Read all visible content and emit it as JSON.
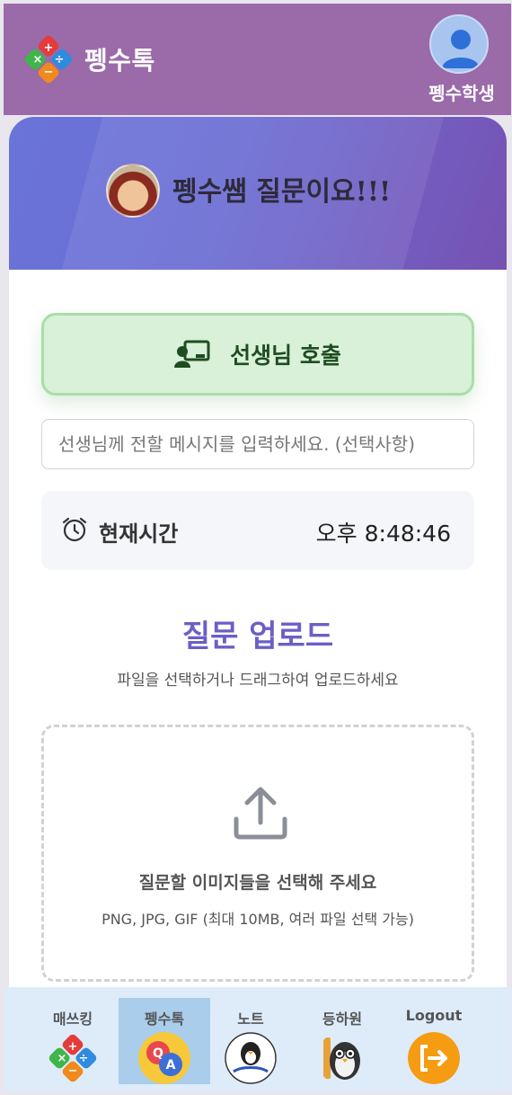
{
  "header": {
    "brand": "펭수톡",
    "user_name": "펭수학생",
    "logo_icon": "math-operators-logo-icon",
    "avatar_icon": "user-avatar-icon"
  },
  "hero": {
    "title": "펭수쌤 질문이요!!!"
  },
  "call_button": {
    "label": "선생님 호출",
    "icon": "teacher-board-icon"
  },
  "message_input": {
    "placeholder": "선생님께 전할 메시지를 입력하세요. (선택사항)",
    "value": ""
  },
  "clock": {
    "label": "현재시간",
    "value": "오후 8:48:46",
    "icon": "alarm-clock-icon"
  },
  "upload": {
    "title": "질문 업로드",
    "subtitle": "파일을 선택하거나 드래그하여 업로드하세요",
    "drop_title": "질문할 이미지들을 선택해 주세요",
    "drop_hint": "PNG, JPG, GIF (최대 10MB, 여러 파일 선택 가능)",
    "icon": "upload-icon"
  },
  "nav": {
    "items": [
      {
        "label": "매쓰킹",
        "icon": "math-operators-icon",
        "active": false
      },
      {
        "label": "펭수톡",
        "icon": "qa-bubble-icon",
        "active": true
      },
      {
        "label": "노트",
        "icon": "penguin-note-icon",
        "active": false
      },
      {
        "label": "등하원",
        "icon": "owl-teacher-icon",
        "active": false
      },
      {
        "label": "Logout",
        "icon": "logout-icon",
        "active": false
      }
    ]
  },
  "colors": {
    "appbar": "#9a6aa9",
    "hero_start": "#6a74d9",
    "hero_end": "#7752b2",
    "accent_title": "#6a5fc7",
    "call_bg": "#d8f1d8",
    "nav_bg": "#deecfa",
    "nav_active": "#a9cdea",
    "logout_orange": "#f59c12"
  }
}
